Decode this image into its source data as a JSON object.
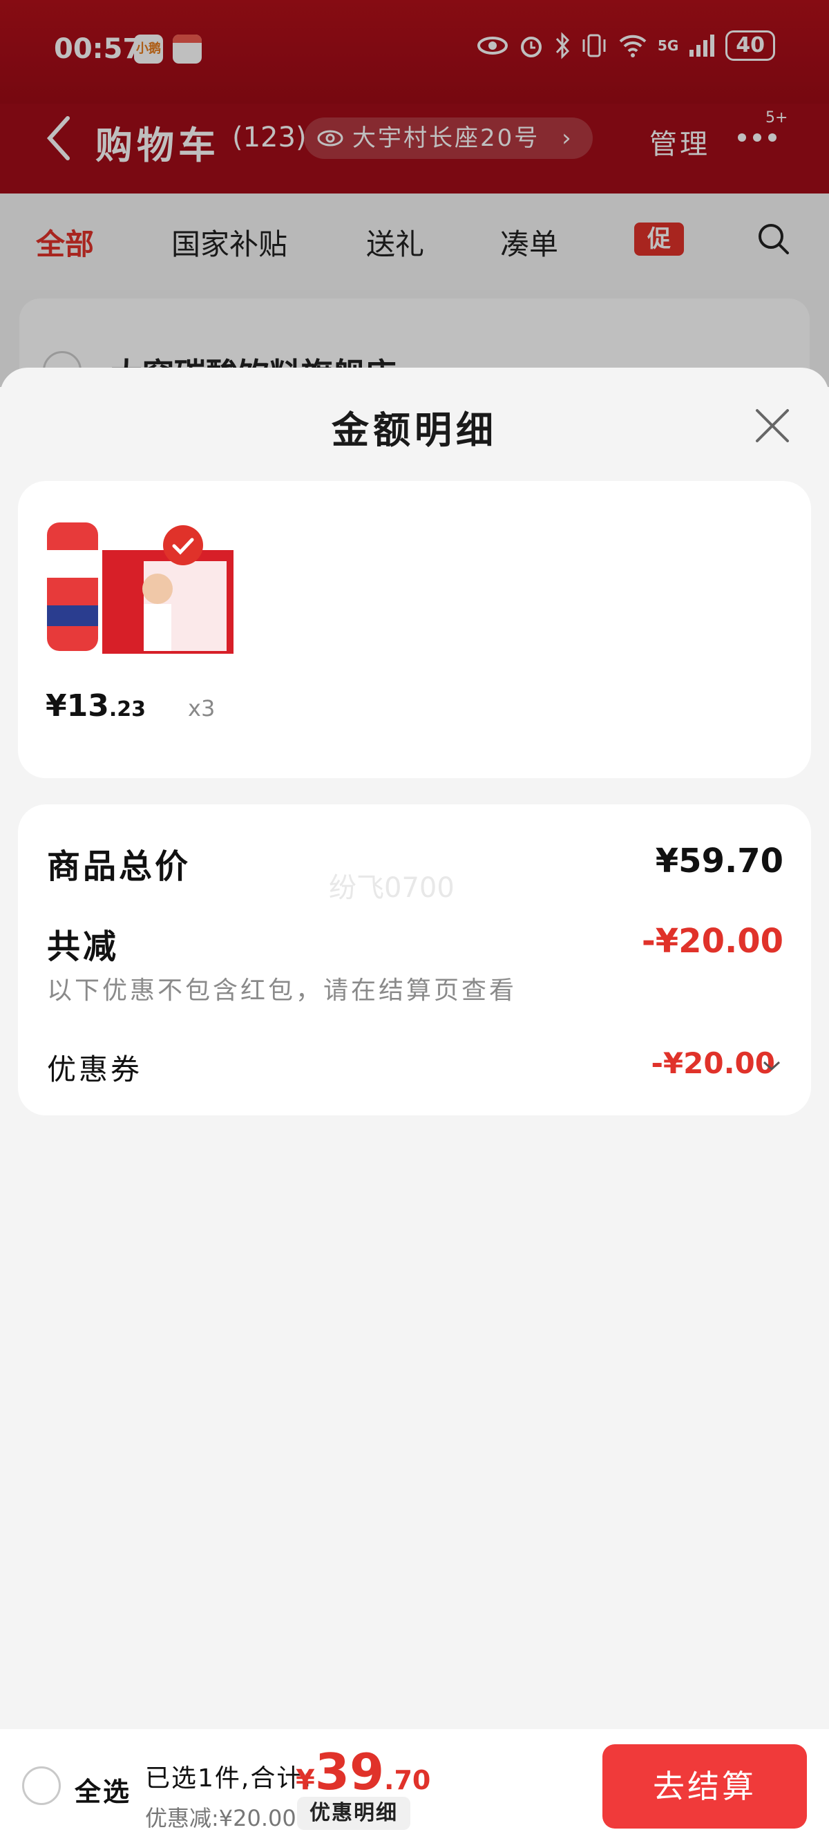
{
  "status_bar": {
    "time": "00:57",
    "app_badge": "小鹅",
    "battery": "40",
    "network": "5G"
  },
  "header": {
    "title": "购物车",
    "count": "(123)",
    "address": "大宇村长座20号",
    "manage": "管理",
    "more_badge": "5+"
  },
  "tabs": [
    {
      "label": "全部",
      "active": true
    },
    {
      "label": "国家补贴"
    },
    {
      "label": "送礼"
    },
    {
      "label": "凑单"
    }
  ],
  "promo_badge": "促",
  "store": {
    "name": "大窑碳酸饮料旗舰店"
  },
  "sheet": {
    "title": "金额明细",
    "product": {
      "price_int": "¥13",
      "price_dec": ".23",
      "qty": "x3"
    },
    "summary": {
      "total_label": "商品总价",
      "total_value": "¥59.70",
      "reduce_label": "共减",
      "reduce_value": "-¥20.00",
      "note": "以下优惠不包含红包，请在结算页查看",
      "coupon_label": "优惠券",
      "coupon_value": "-¥20.00"
    },
    "watermark": "纷飞0700"
  },
  "bottom": {
    "select_all": "全选",
    "selected_text": "已选1件,合计:",
    "currency": "¥",
    "total_int": "39",
    "total_dec": ".70",
    "discount": "优惠减:¥20.00",
    "detail": "优惠明细",
    "checkout": "去结算"
  },
  "colors": {
    "brand_red": "#e0322a",
    "header_red": "#a30d18"
  }
}
